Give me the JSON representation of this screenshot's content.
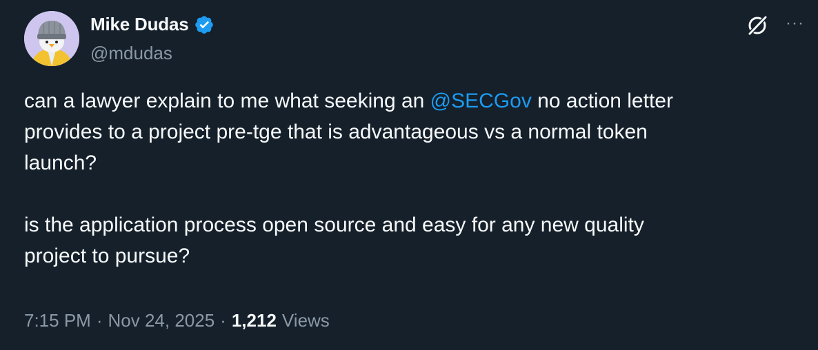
{
  "author": {
    "display_name": "Mike Dudas",
    "handle": "@mdudas",
    "verified": true,
    "verified_color": "#1d9bf0"
  },
  "icons": {
    "grok": "grok-icon",
    "more": "more-icon",
    "more_glyph": "···"
  },
  "tweet": {
    "line1_before": "can a lawyer explain to me what seeking an ",
    "mention": "@SECGov",
    "line1_after": " no action letter",
    "line2": "provides to a project pre-tge that is advantageous vs a normal token",
    "line3": "launch?",
    "line4": "is the application process open source and easy for any new quality",
    "line5": "project to pursue?"
  },
  "meta": {
    "time": "7:15 PM",
    "sep1": "·",
    "date": "Nov 24, 2025",
    "sep2": "·",
    "views_count": "1,212",
    "views_label": "Views"
  },
  "colors": {
    "background": "#15202b",
    "text": "#f7f9f9",
    "secondary": "#8b98a5",
    "accent": "#1d9bf0"
  }
}
